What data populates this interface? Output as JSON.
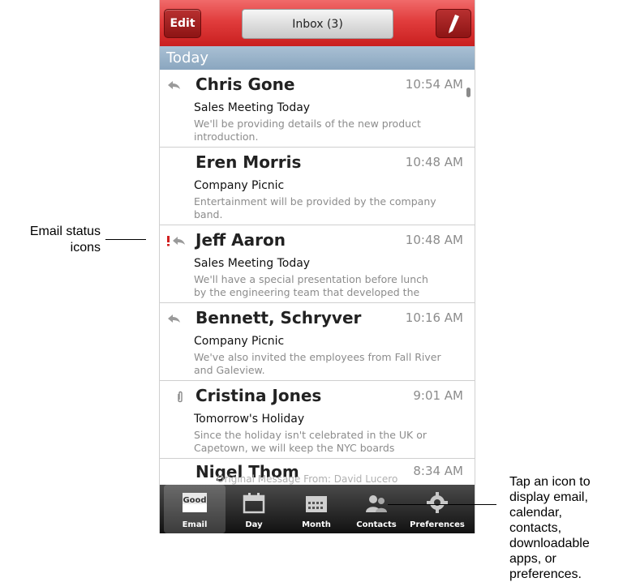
{
  "topbar": {
    "edit_label": "Edit",
    "inbox_label": "Inbox (3)",
    "compose_icon": "pencil-icon"
  },
  "section": {
    "label": "Today"
  },
  "emails": [
    {
      "status_icon": "reply-arrow-icon",
      "sender": "Chris Gone",
      "time": "10:54 AM",
      "subject": "Sales Meeting Today",
      "preview": "We'll be providing details of the new product introduction."
    },
    {
      "status_icon": "",
      "sender": "Eren Morris",
      "time": "10:48 AM",
      "subject": "Company Picnic",
      "preview": "Entertainment will be provided by the company band."
    },
    {
      "status_icon": "priority-reply-icon",
      "sender": "Jeff Aaron",
      "time": "10:48 AM",
      "subject": "Sales Meeting Today",
      "preview": "We'll have a special presentation before lunch by the engineering team that developed the"
    },
    {
      "status_icon": "reply-arrow-icon",
      "sender": "Bennett, Schryver",
      "time": "10:16 AM",
      "subject": "Company Picnic",
      "preview": "We've also invited the employees from Fall River and Galeview."
    },
    {
      "status_icon": "paperclip-icon",
      "sender": "Cristina  Jones",
      "time": "9:01 AM",
      "subject": "Tomorrow's Holiday",
      "preview": "Since the holiday isn't celebrated in the UK or Capetown, we will keep the NYC boards"
    },
    {
      "status_icon": "",
      "sender": "Nigel Thom",
      "time": "8:34 AM",
      "subject": "Original Message      From: David Lucero",
      "preview": ""
    }
  ],
  "tabs": [
    {
      "label": "Email",
      "icon": "good-email-icon"
    },
    {
      "label": "Day",
      "icon": "calendar-day-icon"
    },
    {
      "label": "Month",
      "icon": "calendar-month-icon"
    },
    {
      "label": "Contacts",
      "icon": "contacts-icon"
    },
    {
      "label": "Preferences",
      "icon": "gear-icon"
    }
  ],
  "annotations": {
    "left": "Email status icons",
    "left_line1": "Email status",
    "left_line2": "icons",
    "right": "Tap an icon to display email, calendar, contacts, downloadable apps, or preferences.",
    "right_lines": [
      "Tap an icon to",
      "display email,",
      "calendar,",
      "contacts,",
      "downloadable",
      "apps, or",
      "preferences."
    ]
  },
  "colors": {
    "topbar": "#e13d3d",
    "section": "#8aa6bf",
    "bottombar": "#1a1a1a",
    "priority": "#d12020"
  }
}
